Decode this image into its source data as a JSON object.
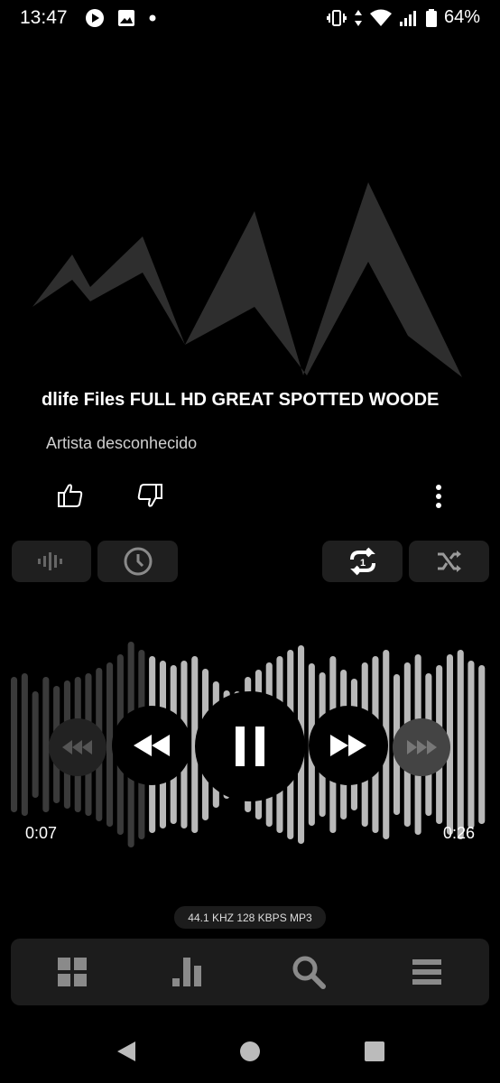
{
  "status_bar": {
    "time": "13:47",
    "battery": "64%"
  },
  "track": {
    "title": "dlife Files FULL HD GREAT SPOTTED WOODE",
    "artist": "Artista desconhecido"
  },
  "playback": {
    "elapsed": "0:07",
    "total": "0:26",
    "progress_fraction": 0.27,
    "state": "playing"
  },
  "format_info": "44.1 KHZ 128 KBPS MP3",
  "toggles": {
    "repeat_one_icon": "repeat-one-icon",
    "shuffle_icon": "shuffle-icon"
  },
  "colors": {
    "background": "#000000",
    "pill": "#1f1f1f",
    "wave_played": "#3a3a3a",
    "wave_unplayed": "#b9b9b9"
  }
}
